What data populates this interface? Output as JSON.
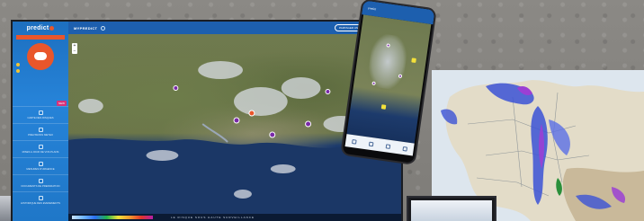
{
  "laptop": {
    "logo": "predict",
    "alert_strip": "",
    "badge": "NEW",
    "menu": [
      {
        "label": "CARTE DES RISQUES"
      },
      {
        "label": "PREVISIONS METEO"
      },
      {
        "label": "MISES A JOUR DE VOS PLANS"
      },
      {
        "label": "MESURES D'URGENCE"
      },
      {
        "label": "DOCUMENTS DE PREPARATION"
      },
      {
        "label": "HISTORIQUE DES EVENEMENTS"
      }
    ],
    "footer": "",
    "topbar": {
      "brand": "MYPREDICT",
      "share": "PARTAGER UNE INFO",
      "phone": "ASSISTANCE"
    },
    "motto": "LE RISQUE SOUS HAUTE SURVEILLANCE"
  },
  "phone": {
    "header": "predict"
  },
  "colors": {
    "sidebar": "#2683d8",
    "accent_orange": "#e9562b",
    "topbar": "#1d5fae",
    "radar_blue": "#3b52d6",
    "radar_purple": "#9b3fd4"
  }
}
